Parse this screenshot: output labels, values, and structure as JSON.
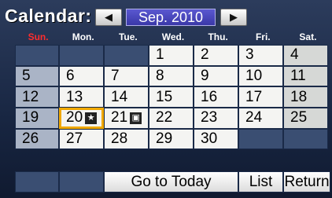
{
  "header": {
    "title": "Calendar:",
    "month_label": "Sep. 2010",
    "prev_icon": "◀",
    "next_icon": "▶"
  },
  "weekdays": [
    "Sun.",
    "Mon.",
    "Tue.",
    "Wed.",
    "Thu.",
    "Fri.",
    "Sat."
  ],
  "weeks": [
    [
      "",
      "",
      "",
      "1",
      "2",
      "3",
      "4"
    ],
    [
      "5",
      "6",
      "7",
      "8",
      "9",
      "10",
      "11"
    ],
    [
      "12",
      "13",
      "14",
      "15",
      "16",
      "17",
      "18"
    ],
    [
      "19",
      "20",
      "21",
      "22",
      "23",
      "24",
      "25"
    ],
    [
      "26",
      "27",
      "28",
      "29",
      "30",
      "",
      ""
    ]
  ],
  "selected_day": "20",
  "day_badges": {
    "20": {
      "icon": "star-icon",
      "glyph": "★"
    },
    "21": {
      "icon": "note-icon",
      "glyph": "▣"
    }
  },
  "buttons": {
    "today": "Go to Today",
    "list": "List",
    "return": "Return"
  },
  "colors": {
    "sunday": "#ff2d2d",
    "selection": "#f0a800",
    "month_bar": "#4a48c0"
  }
}
